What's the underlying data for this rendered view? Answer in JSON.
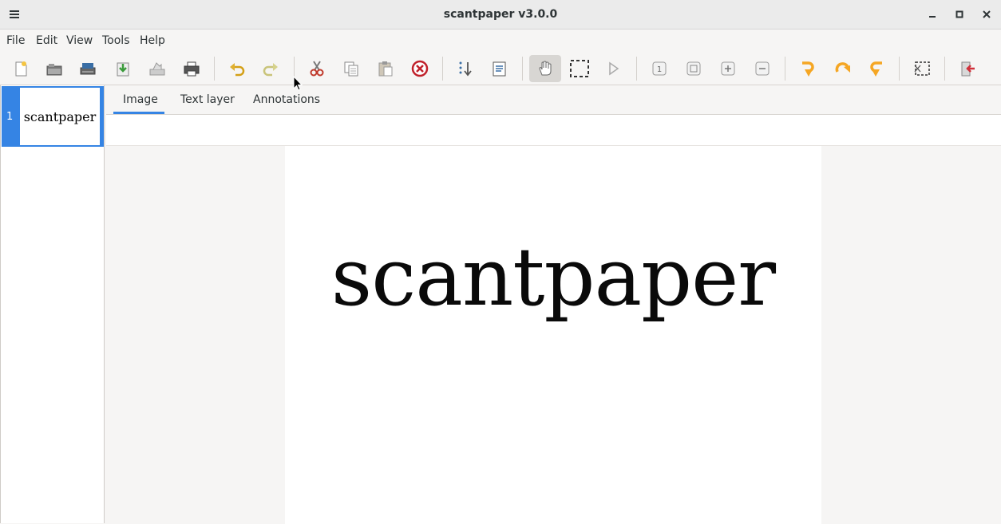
{
  "window": {
    "title": "scantpaper v3.0.0",
    "controls": [
      "minimize-icon",
      "maximize-icon",
      "close-icon"
    ]
  },
  "menubar": {
    "items": [
      "File",
      "Edit",
      "View",
      "Tools",
      "Help"
    ]
  },
  "toolbar": {
    "buttons": [
      {
        "name": "new-icon"
      },
      {
        "name": "open-icon"
      },
      {
        "name": "scan-icon"
      },
      {
        "name": "save-icon"
      },
      {
        "name": "email-icon"
      },
      {
        "name": "print-icon"
      },
      {
        "name": "undo-icon"
      },
      {
        "name": "redo-icon"
      },
      {
        "name": "cut-icon"
      },
      {
        "name": "copy-icon"
      },
      {
        "name": "paste-icon"
      },
      {
        "name": "delete-icon"
      },
      {
        "name": "renumber-icon"
      },
      {
        "name": "ocr-icon"
      },
      {
        "name": "pan-tool-icon",
        "active": true
      },
      {
        "name": "select-tool-icon"
      },
      {
        "name": "play-icon"
      },
      {
        "name": "zoom-100-icon"
      },
      {
        "name": "zoom-fit-icon"
      },
      {
        "name": "zoom-in-icon"
      },
      {
        "name": "zoom-out-icon"
      },
      {
        "name": "rotate-90-icon"
      },
      {
        "name": "rotate-180-icon"
      },
      {
        "name": "rotate-270-icon"
      },
      {
        "name": "crop-icon"
      },
      {
        "name": "quit-icon"
      }
    ],
    "accent": "#f5a623"
  },
  "thumbnails": [
    {
      "number": "1",
      "label": "scantpaper",
      "selected": true
    }
  ],
  "tabs": {
    "items": [
      "Image",
      "Text layer",
      "Annotations"
    ],
    "active": "Image"
  },
  "page": {
    "text": "scantpaper"
  },
  "colors": {
    "selection": "#3584e4",
    "titlebar": "#ebebeb",
    "background": "#f6f5f4"
  }
}
